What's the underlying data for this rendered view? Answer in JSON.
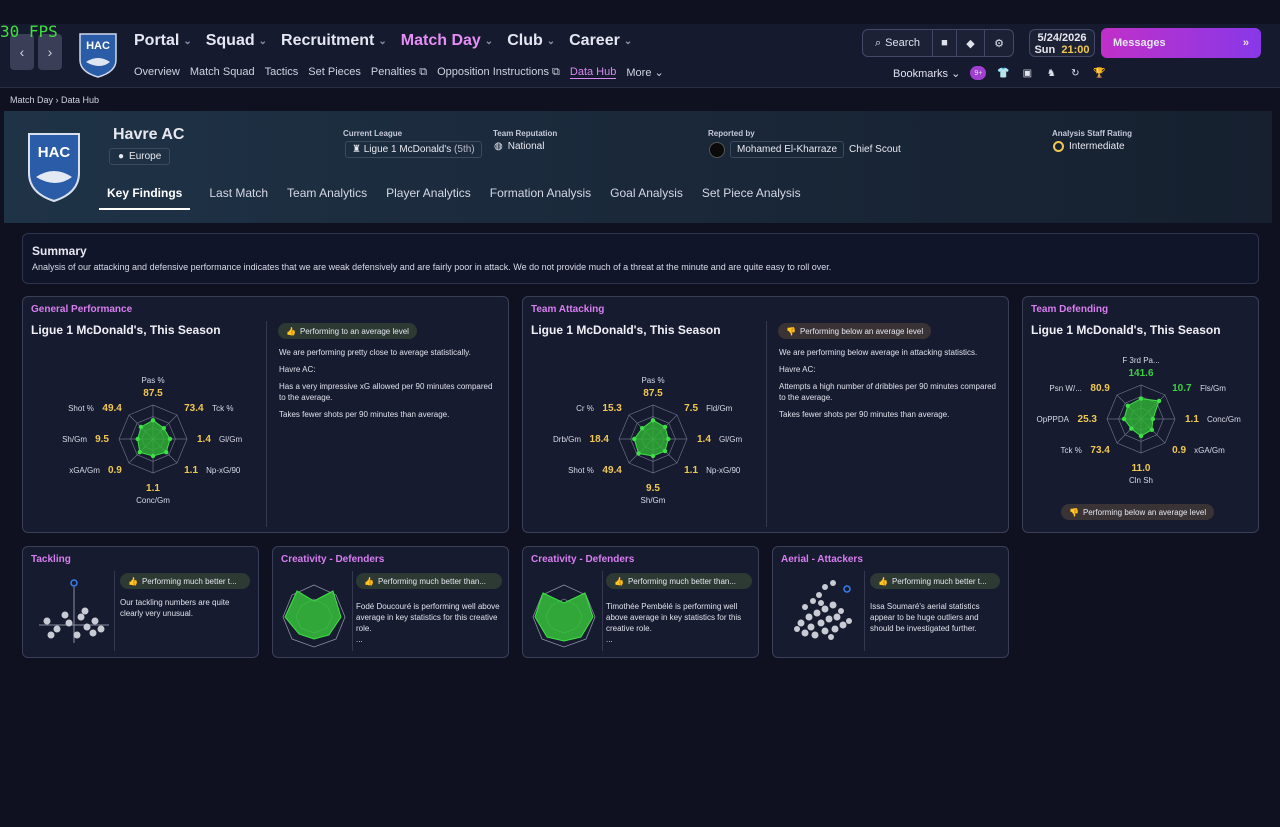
{
  "fps": "30 FPS",
  "colors": {
    "accent": "#d77ef0",
    "good": "#3ecf45",
    "value": "#f0c850",
    "bg": "#0f1120"
  },
  "nav": {
    "main": [
      {
        "label": "Portal"
      },
      {
        "label": "Squad"
      },
      {
        "label": "Recruitment"
      },
      {
        "label": "Match Day",
        "active": true
      },
      {
        "label": "Club"
      },
      {
        "label": "Career"
      }
    ],
    "sub": [
      "Overview",
      "Match Squad",
      "Tactics",
      "Set Pieces",
      "Penalties",
      "Opposition Instructions",
      "Data Hub",
      "More"
    ],
    "search_label": "Search",
    "date": "5/24/2026",
    "day": "Sun",
    "time": "21:00",
    "messages_label": "Messages",
    "bookmarks_label": "Bookmarks",
    "bookmarks_badge": "9+",
    "crest_text": "HAC"
  },
  "breadcrumb": {
    "parent": "Match Day",
    "current": "Data Hub"
  },
  "hero": {
    "club_name": "Havre AC",
    "region": "Europe",
    "current_league_label": "Current League",
    "current_league": "Ligue 1 McDonald's",
    "league_position": "(5th)",
    "reputation_label": "Team Reputation",
    "reputation": "National",
    "reported_by_label": "Reported by",
    "scout_name": "Mohamed El-Kharraze",
    "scout_role": "Chief Scout",
    "staff_rating_label": "Analysis Staff Rating",
    "staff_rating": "Intermediate",
    "tabs": [
      "Key Findings",
      "Last Match",
      "Team Analytics",
      "Player Analytics",
      "Formation Analysis",
      "Goal Analysis",
      "Set Piece Analysis"
    ]
  },
  "summary": {
    "title": "Summary",
    "text": "Analysis of our attacking and defensive performance indicates that we are weak defensively and are fairly poor in attack. We do not provide much of a threat at the minute and are quite easy to roll over."
  },
  "cards": {
    "general": {
      "title": "General Performance",
      "subtitle": "Ligue 1 McDonald's, This Season",
      "badge": "Performing to an average level",
      "lines": [
        "We are performing pretty close to average statistically.",
        "Havre AC:",
        "Has a very impressive xG allowed per 90 minutes compared to the average.",
        "Takes fewer shots per 90 minutes than average."
      ],
      "radar": [
        {
          "label": "Pas %",
          "value": "87.5"
        },
        {
          "label": "Tck %",
          "value": "73.4"
        },
        {
          "label": "Gl/Gm",
          "value": "1.4"
        },
        {
          "label": "Np-xG/90",
          "value": "1.1"
        },
        {
          "label": "Conc/Gm",
          "value": "1.1"
        },
        {
          "label": "xGA/Gm",
          "value": "0.9"
        },
        {
          "label": "Sh/Gm",
          "value": "9.5"
        },
        {
          "label": "Shot %",
          "value": "49.4"
        }
      ]
    },
    "attacking": {
      "title": "Team Attacking",
      "subtitle": "Ligue 1 McDonald's, This Season",
      "badge": "Performing below an average level",
      "lines": [
        "We are performing below average in attacking statistics.",
        "Havre AC:",
        "Attempts a high number of dribbles per 90 minutes compared to the average.",
        "Takes fewer shots per 90 minutes than average."
      ],
      "radar": [
        {
          "label": "Pas %",
          "value": "87.5"
        },
        {
          "label": "Fld/Gm",
          "value": "7.5"
        },
        {
          "label": "Gl/Gm",
          "value": "1.4"
        },
        {
          "label": "Np-xG/90",
          "value": "1.1"
        },
        {
          "label": "Sh/Gm",
          "value": "9.5"
        },
        {
          "label": "Shot %",
          "value": "49.4"
        },
        {
          "label": "Drb/Gm",
          "value": "18.4"
        },
        {
          "label": "Cr %",
          "value": "15.3"
        }
      ]
    },
    "defending": {
      "title": "Team Defending",
      "subtitle": "Ligue 1 McDonald's, This Season",
      "badge": "Performing below an average level",
      "radar": [
        {
          "label": "F 3rd Pa...",
          "value": "141.6"
        },
        {
          "label": "Fls/Gm",
          "value": "10.7"
        },
        {
          "label": "Conc/Gm",
          "value": "1.1"
        },
        {
          "label": "xGA/Gm",
          "value": "0.9"
        },
        {
          "label": "Cln Sh",
          "value": "11.0"
        },
        {
          "label": "Tck %",
          "value": "73.4"
        },
        {
          "label": "OpPPDA",
          "value": "25.3"
        },
        {
          "label": "Psn W/...",
          "value": "80.9"
        }
      ]
    },
    "tackling": {
      "title": "Tackling",
      "badge": "Performing much better t...",
      "text": "Our tackling numbers are quite clearly very unusual."
    },
    "creativity1": {
      "title": "Creativity - Defenders",
      "badge": "Performing much better than...",
      "text": "Fodé Doucouré is performing well above average in key statistics for this creative role.",
      "more": "..."
    },
    "creativity2": {
      "title": "Creativity - Defenders",
      "badge": "Performing much better than...",
      "text": "Timothée Pembélé is performing well above average in key statistics for this creative role.",
      "more": "..."
    },
    "aerial": {
      "title": "Aerial - Attackers",
      "badge": "Performing much better t...",
      "text": "Issa Soumaré's aerial statistics appear to be huge outliers and should be investigated further."
    }
  }
}
